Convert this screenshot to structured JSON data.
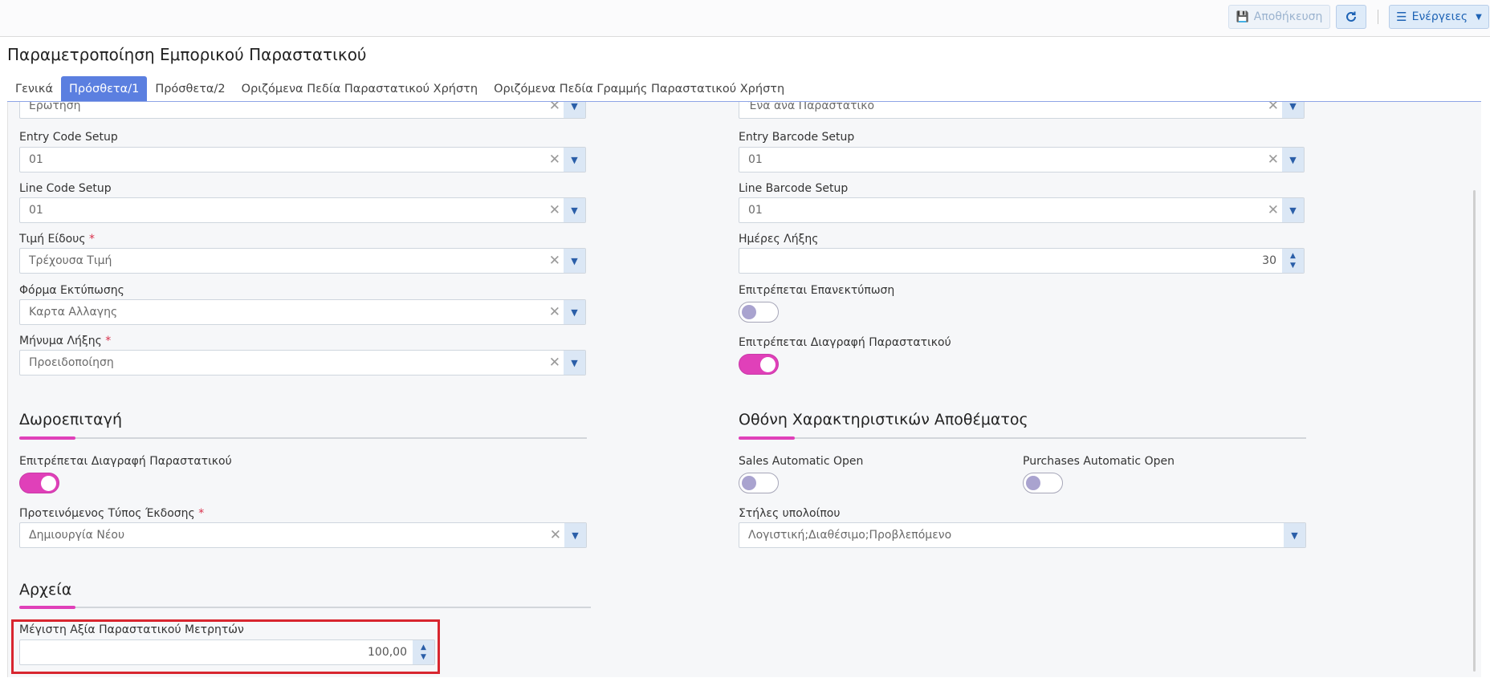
{
  "toolbar": {
    "save_label": "Αποθήκευση",
    "refresh_icon": "refresh-icon",
    "actions_label": "Ενέργειες"
  },
  "page": {
    "title": "Παραμετροποίηση Εμπορικού Παραστατικού"
  },
  "tabs": [
    {
      "label": "Γενικά",
      "active": false
    },
    {
      "label": "Πρόσθετα/1",
      "active": true
    },
    {
      "label": "Πρόσθετα/2",
      "active": false
    },
    {
      "label": "Οριζόμενα Πεδία Παραστατικού Χρήστη",
      "active": false
    },
    {
      "label": "Οριζόμενα Πεδία Γραμμής Παραστατικού Χρήστη",
      "active": false
    }
  ],
  "left": {
    "top_select_value": "Ερώτηση",
    "entry_code": {
      "label": "Entry Code Setup",
      "value": "01"
    },
    "line_code": {
      "label": "Line Code Setup",
      "value": "01"
    },
    "price": {
      "label": "Τιμή Είδους",
      "required": "*",
      "value": "Τρέχουσα Τιμή"
    },
    "print_form": {
      "label": "Φόρμα Εκτύπωσης",
      "value": "Καρτα Αλλαγης"
    },
    "expiry_msg": {
      "label": "Μήνυμα Λήξης",
      "required": "*",
      "value": "Προειδοποίηση"
    }
  },
  "right": {
    "top_select_value": "Ένα ανά Παραστατικό",
    "entry_barcode": {
      "label": "Entry Barcode Setup",
      "value": "01"
    },
    "line_barcode": {
      "label": "Line Barcode Setup",
      "value": "01"
    },
    "expiry_days": {
      "label": "Ημέρες Λήξης",
      "value": "30"
    },
    "allow_reprint": {
      "label": "Επιτρέπεται Επανεκτύπωση",
      "on": false
    },
    "allow_delete": {
      "label": "Επιτρέπεται Διαγραφή Παραστατικού",
      "on": true
    }
  },
  "gift": {
    "title": "Δωροεπιταγή",
    "allow_delete": {
      "label": "Επιτρέπεται Διαγραφή Παραστατικού",
      "on": true
    },
    "issue_type": {
      "label": "Προτεινόμενος Τύπος Έκδοσης",
      "required": "*",
      "value": "Δημιουργία Νέου"
    }
  },
  "stock": {
    "title": "Οθόνη Χαρακτηριστικών Αποθέματος",
    "sales_open": {
      "label": "Sales Automatic Open",
      "on": false
    },
    "purchases_open": {
      "label": "Purchases Automatic Open",
      "on": false
    },
    "balance_cols": {
      "label": "Στήλες υπολοίπου",
      "value": "Λογιστική;Διαθέσιμο;Προβλεπόμενο"
    }
  },
  "files": {
    "title": "Αρχεία",
    "max_cash": {
      "label": "Μέγιστη Αξία Παραστατικού Μετρητών",
      "value": "100,00"
    }
  },
  "colors": {
    "accent": "#e040b9",
    "tab_active": "#5b7fe0",
    "highlight": "#d8262f"
  }
}
